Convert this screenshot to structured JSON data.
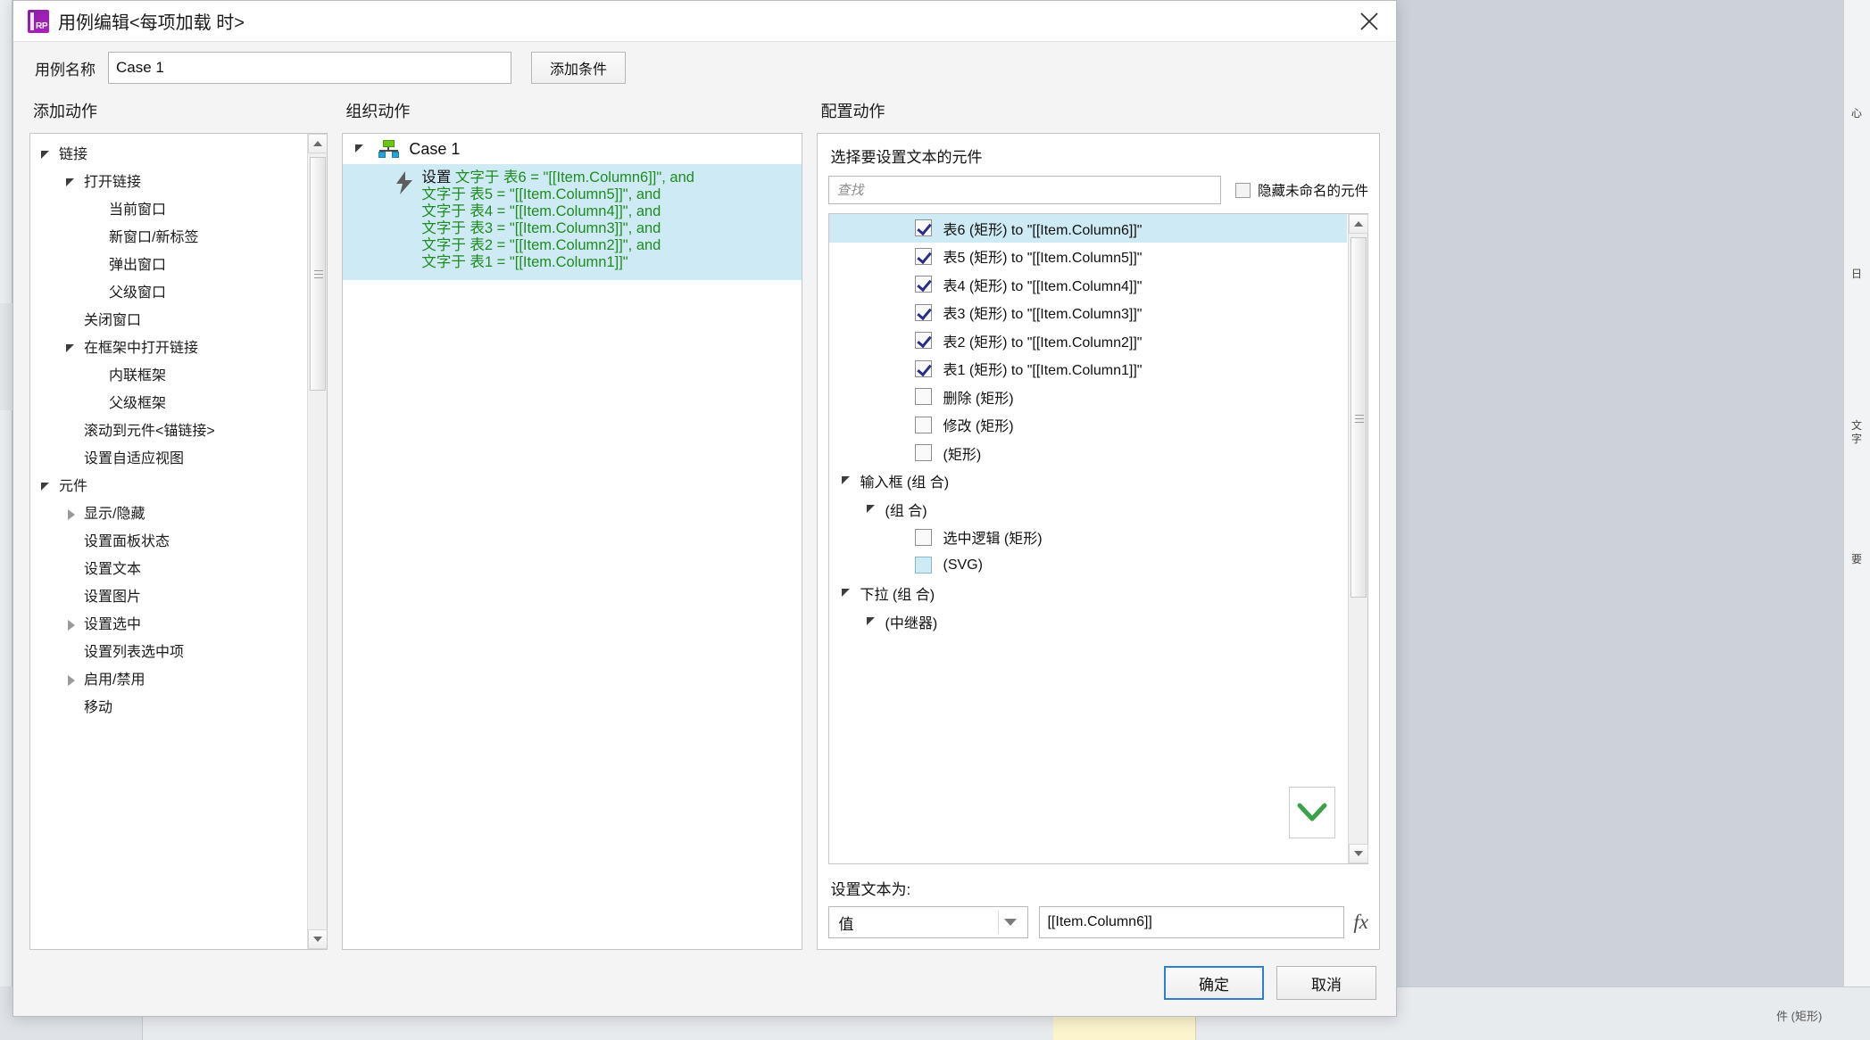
{
  "window": {
    "title": "用例编辑<每项加载 时>",
    "logo_text": "RP",
    "close_icon": "close-icon"
  },
  "case_bar": {
    "label": "用例名称",
    "value": "Case 1",
    "placeholder": "Case 1",
    "add_condition_label": "添加条件"
  },
  "add_action": {
    "heading": "添加动作",
    "items": [
      {
        "label": "链接",
        "indent": 0,
        "caret": "open"
      },
      {
        "label": "打开链接",
        "indent": 1,
        "caret": "open"
      },
      {
        "label": "当前窗口",
        "indent": 2,
        "caret": "none"
      },
      {
        "label": "新窗口/新标签",
        "indent": 2,
        "caret": "none"
      },
      {
        "label": "弹出窗口",
        "indent": 2,
        "caret": "none"
      },
      {
        "label": "父级窗口",
        "indent": 2,
        "caret": "none"
      },
      {
        "label": "关闭窗口",
        "indent": 1,
        "caret": "none"
      },
      {
        "label": "在框架中打开链接",
        "indent": 1,
        "caret": "open"
      },
      {
        "label": "内联框架",
        "indent": 2,
        "caret": "none"
      },
      {
        "label": "父级框架",
        "indent": 2,
        "caret": "none"
      },
      {
        "label": "滚动到元件<锚链接>",
        "indent": 1,
        "caret": "none"
      },
      {
        "label": "设置自适应视图",
        "indent": 1,
        "caret": "none"
      },
      {
        "label": "元件",
        "indent": 0,
        "caret": "open"
      },
      {
        "label": "显示/隐藏",
        "indent": 1,
        "caret": "closed"
      },
      {
        "label": "设置面板状态",
        "indent": 1,
        "caret": "none"
      },
      {
        "label": "设置文本",
        "indent": 1,
        "caret": "none"
      },
      {
        "label": "设置图片",
        "indent": 1,
        "caret": "none"
      },
      {
        "label": "设置选中",
        "indent": 1,
        "caret": "closed"
      },
      {
        "label": "设置列表选中项",
        "indent": 1,
        "caret": "none"
      },
      {
        "label": "启用/禁用",
        "indent": 1,
        "caret": "closed"
      },
      {
        "label": "移动",
        "indent": 1,
        "caret": "none"
      }
    ]
  },
  "organize_action": {
    "heading": "组织动作",
    "root_label": "Case 1",
    "root_icon": "sitemap-icon",
    "action_icon": "lightning-bolt-icon",
    "action_lines": [
      {
        "prefix": "设置 ",
        "text": "文字于 表6 = \"[[Item.Column6]]\", and"
      },
      {
        "prefix": "",
        "text": "文字于 表5 = \"[[Item.Column5]]\", and"
      },
      {
        "prefix": "",
        "text": "文字于 表4 = \"[[Item.Column4]]\", and"
      },
      {
        "prefix": "",
        "text": "文字于 表3 = \"[[Item.Column3]]\", and"
      },
      {
        "prefix": "",
        "text": "文字于 表2 = \"[[Item.Column2]]\", and"
      },
      {
        "prefix": "",
        "text": "文字于 表1 = \"[[Item.Column1]]\""
      }
    ]
  },
  "configure_action": {
    "heading": "配置动作",
    "select_widgets_label": "选择要设置文本的元件",
    "search_placeholder": "查找",
    "search_value": "",
    "hide_unnamed_label": "隐藏未命名的元件",
    "hide_unnamed_checked": false,
    "widget_list": [
      {
        "label": "表6 (矩形) to \"[[Item.Column6]]\"",
        "indent": 3,
        "checkbox": "checked",
        "selected": true,
        "caret": "none"
      },
      {
        "label": "表5 (矩形) to \"[[Item.Column5]]\"",
        "indent": 3,
        "checkbox": "checked",
        "selected": false,
        "caret": "none"
      },
      {
        "label": "表4 (矩形) to \"[[Item.Column4]]\"",
        "indent": 3,
        "checkbox": "checked",
        "selected": false,
        "caret": "none"
      },
      {
        "label": "表3 (矩形) to \"[[Item.Column3]]\"",
        "indent": 3,
        "checkbox": "checked",
        "selected": false,
        "caret": "none"
      },
      {
        "label": "表2 (矩形) to \"[[Item.Column2]]\"",
        "indent": 3,
        "checkbox": "checked",
        "selected": false,
        "caret": "none"
      },
      {
        "label": "表1 (矩形) to \"[[Item.Column1]]\"",
        "indent": 3,
        "checkbox": "checked",
        "selected": false,
        "caret": "none"
      },
      {
        "label": "删除 (矩形)",
        "indent": 3,
        "checkbox": "unchecked",
        "selected": false,
        "caret": "none"
      },
      {
        "label": "修改 (矩形)",
        "indent": 3,
        "checkbox": "unchecked",
        "selected": false,
        "caret": "none"
      },
      {
        "label": "(矩形)",
        "indent": 3,
        "checkbox": "unchecked",
        "selected": false,
        "caret": "none"
      },
      {
        "label": "输入框 (组 合)",
        "indent": 0,
        "checkbox": "none",
        "selected": false,
        "caret": "open"
      },
      {
        "label": "(组 合)",
        "indent": 1,
        "checkbox": "none",
        "selected": false,
        "caret": "open"
      },
      {
        "label": "选中逻辑 (矩形)",
        "indent": 3,
        "checkbox": "unchecked",
        "selected": false,
        "caret": "none"
      },
      {
        "label": "(SVG)",
        "indent": 3,
        "checkbox": "blue",
        "selected": false,
        "caret": "none"
      },
      {
        "label": "下拉 (组 合)",
        "indent": 0,
        "checkbox": "none",
        "selected": false,
        "caret": "open"
      },
      {
        "label": "(中继器)",
        "indent": 1,
        "checkbox": "none",
        "selected": false,
        "caret": "open"
      }
    ],
    "set_text_label": "设置文本为:",
    "value_select": "值",
    "value_text": "[[Item.Column6]]",
    "fx_label": "fx",
    "scroll_down_icon": "chevron-down-icon"
  },
  "footer": {
    "ok_label": "确定",
    "cancel_label": "取消"
  },
  "backdrop": {
    "right_rail_text": "心ㅣ日ㅣ文ㅣ字ㅣ要",
    "bottom_label": "件 (矩形)"
  },
  "colors": {
    "accent_blue": "#2f7fd0",
    "selection_blue": "#cdeaf5",
    "action_green": "#1f8c1f",
    "logo_purple": "#9c1fb3",
    "check_navy": "#2b2f86"
  }
}
